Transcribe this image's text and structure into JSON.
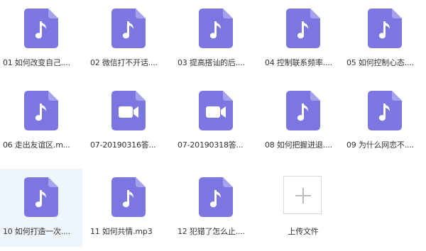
{
  "files": [
    {
      "name": "01 如何改变自己....",
      "type": "audio"
    },
    {
      "name": "02 微信打不开话....",
      "type": "audio"
    },
    {
      "name": "03 提高搭讪的后....",
      "type": "audio"
    },
    {
      "name": "04 控制联系频率....",
      "type": "audio"
    },
    {
      "name": "05 如何控制心态....",
      "type": "audio"
    },
    {
      "name": "06 走出友谊区.m...",
      "type": "audio"
    },
    {
      "name": "07-20190316答...",
      "type": "video"
    },
    {
      "name": "07-20190318答...",
      "type": "video"
    },
    {
      "name": "08 如何把握进退....",
      "type": "audio"
    },
    {
      "name": "09 为什么网恋不....",
      "type": "audio"
    },
    {
      "name": "10 如何打造一次....",
      "type": "audio"
    },
    {
      "name": "11 如何共情.mp3",
      "type": "audio"
    },
    {
      "name": "12 犯错了怎么止....",
      "type": "audio"
    }
  ],
  "upload": {
    "label": "上传文件"
  },
  "colors": {
    "icon": "#7b76e0",
    "icon_fold": "#a6a2ee",
    "hover": "#eef5fb"
  }
}
